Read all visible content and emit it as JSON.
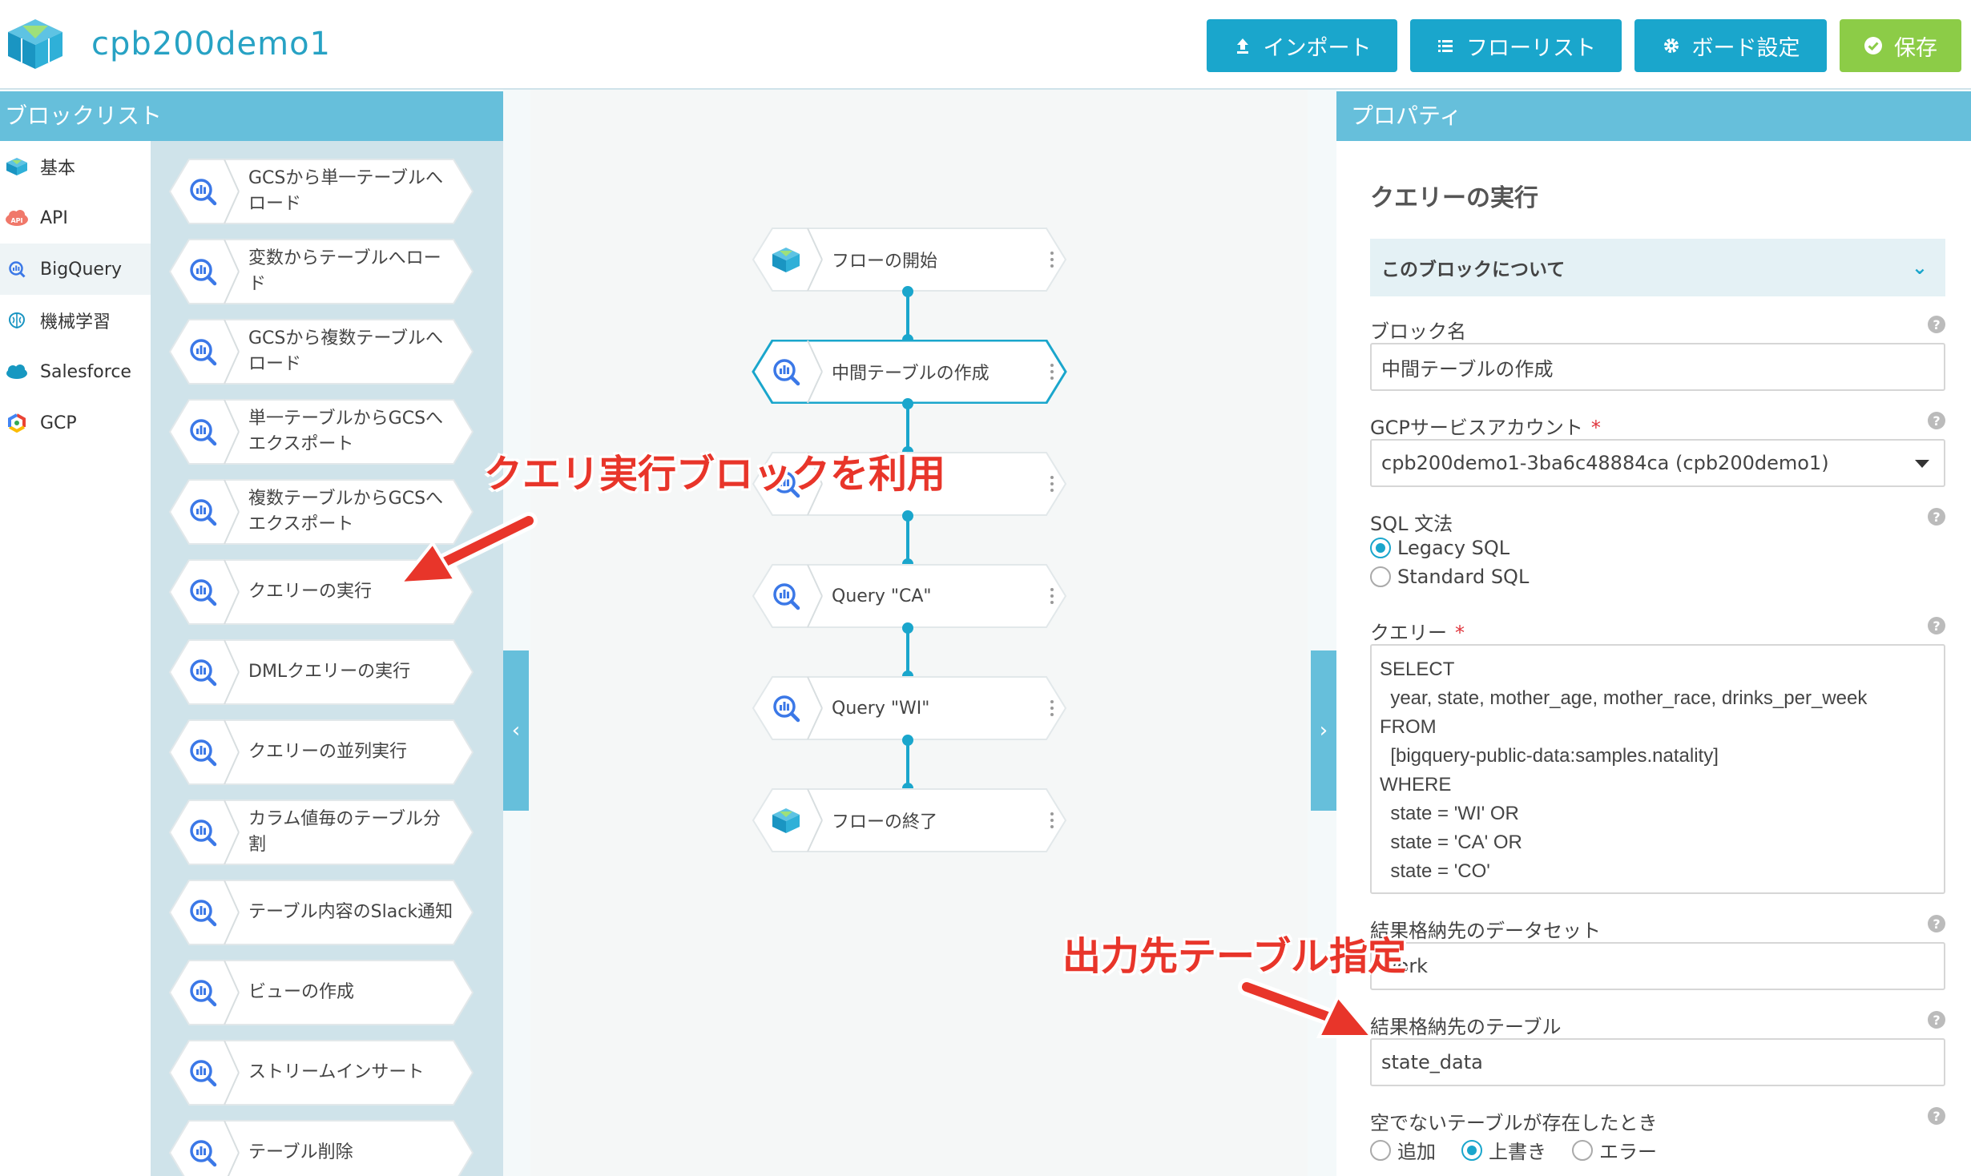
{
  "header": {
    "app_title": "cpb200demo1",
    "buttons": {
      "import": "インポート",
      "flow_list": "フローリスト",
      "board_settings": "ボード設定",
      "save": "保存"
    },
    "colors": {
      "accent": "#1aa6cc",
      "save": "#8ccc47"
    }
  },
  "left_panel": {
    "title": "ブロックリスト",
    "categories": [
      {
        "label": "基本",
        "icon": "magic-cube-icon"
      },
      {
        "label": "API",
        "icon": "api-cloud-icon"
      },
      {
        "label": "BigQuery",
        "icon": "bigquery-icon"
      },
      {
        "label": "機械学習",
        "icon": "brain-icon"
      },
      {
        "label": "Salesforce",
        "icon": "salesforce-cloud-icon"
      },
      {
        "label": "GCP",
        "icon": "gcp-hexagon-icon"
      }
    ],
    "active_category": "BigQuery",
    "blocks": [
      "GCSから単一テーブルへロード",
      "変数からテーブルへロード",
      "GCSから複数テーブルへロード",
      "単一テーブルからGCSへエクスポート",
      "複数テーブルからGCSへエクスポート",
      "クエリーの実行",
      "DMLクエリーの実行",
      "クエリーの並列実行",
      "カラム値毎のテーブル分割",
      "テーブル内容のSlack通知",
      "ビューの作成",
      "ストリームインサート",
      "テーブル削除"
    ]
  },
  "flow": {
    "nodes": [
      {
        "label": "フローの開始",
        "icon": "magic-cube-icon",
        "selected": false
      },
      {
        "label": "中間テーブルの作成",
        "icon": "bigquery-icon",
        "selected": true
      },
      {
        "label": "",
        "icon": "bigquery-icon",
        "selected": false
      },
      {
        "label": "Query \"CA\"",
        "icon": "bigquery-icon",
        "selected": false
      },
      {
        "label": "Query \"WI\"",
        "icon": "bigquery-icon",
        "selected": false
      },
      {
        "label": "フローの終了",
        "icon": "magic-cube-icon",
        "selected": false
      }
    ]
  },
  "properties": {
    "panel_title": "プロパティ",
    "block_title": "クエリーの実行",
    "about_label": "このブロックについて",
    "block_name_label": "ブロック名",
    "block_name_value": "中間テーブルの作成",
    "service_account_label": "GCPサービスアカウント",
    "service_account_value": "cpb200demo1-3ba6c48884ca (cpb200demo1)",
    "sql_dialect_label": "SQL 文法",
    "sql_options": [
      "Legacy SQL",
      "Standard SQL"
    ],
    "sql_selected": "Legacy SQL",
    "query_label": "クエリー",
    "query_value": "SELECT\n  year, state, mother_age, mother_race, drinks_per_week\nFROM\n  [bigquery-public-data:samples.natality]\nWHERE\n  state = 'WI' OR\n  state = 'CA' OR\n  state = 'CO'",
    "dataset_label": "結果格納先のデータセット",
    "dataset_value": "work",
    "table_label": "結果格納先のテーブル",
    "table_value": "state_data",
    "non_empty_label": "空でないテーブルが存在したとき",
    "non_empty_options": [
      "追加",
      "上書き",
      "エラー"
    ],
    "non_empty_selected": "上書き",
    "required_mark": "*",
    "help_mark": "?"
  },
  "annotations": {
    "use_query_block": "クエリ実行ブロックを利用",
    "output_table": "出力先テーブル指定"
  }
}
